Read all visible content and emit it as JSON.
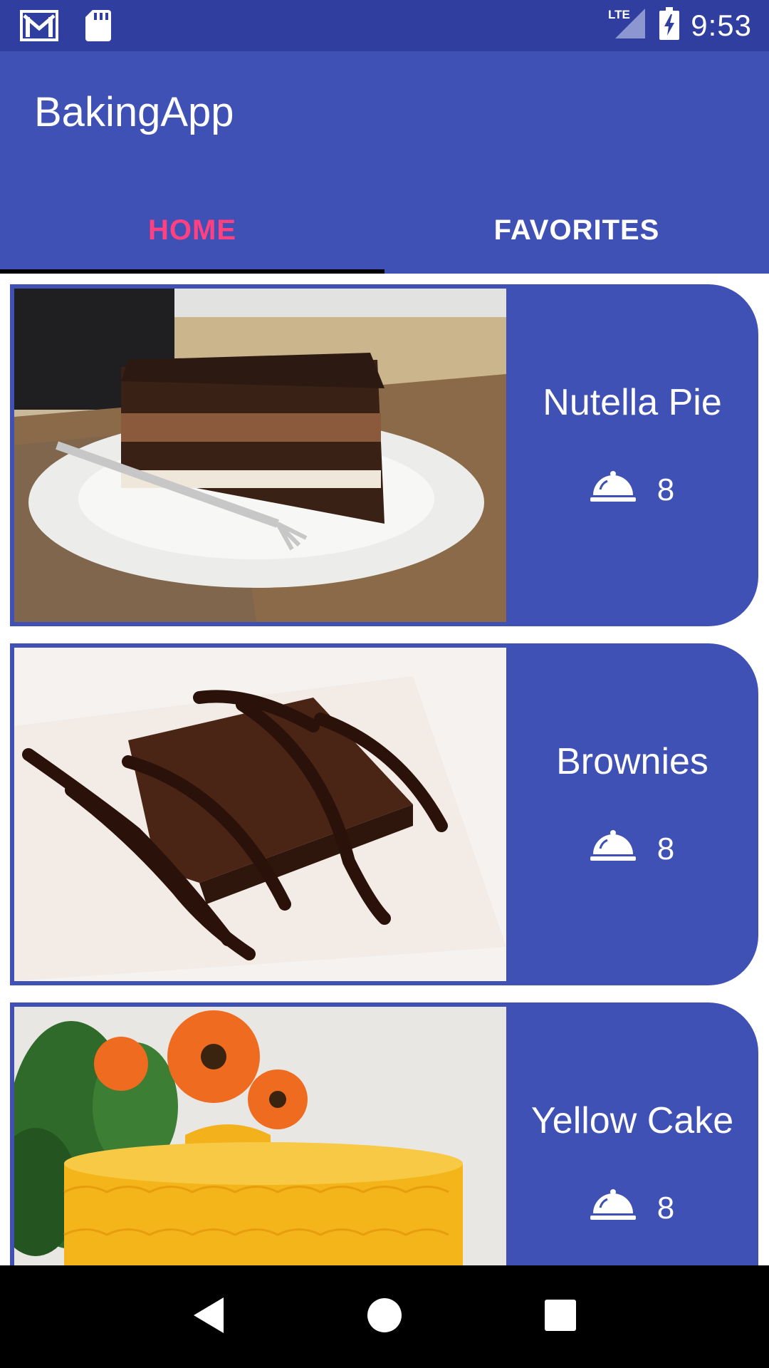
{
  "status_bar": {
    "time": "9:53",
    "network": "LTE",
    "icons": [
      "gmail-icon",
      "sd-card-icon",
      "lte-signal-icon",
      "battery-charging-icon"
    ]
  },
  "app_bar": {
    "title": "BakingApp",
    "tabs": [
      {
        "label": "HOME",
        "selected": true
      },
      {
        "label": "FAVORITES",
        "selected": false
      }
    ]
  },
  "recipes": [
    {
      "name": "Nutella Pie",
      "servings": "8",
      "image": "chocolate-layer-cake-photo"
    },
    {
      "name": "Brownies",
      "servings": "8",
      "image": "brownie-chocolate-drizzle-photo"
    },
    {
      "name": "Yellow Cake",
      "servings": "8",
      "image": "yellow-cake-flowers-photo"
    }
  ],
  "nav_bar": {
    "icons": [
      "back-icon",
      "home-icon",
      "recents-icon"
    ]
  },
  "colors": {
    "primary": "#3f51b5",
    "primary_dark": "#303f9f",
    "accent": "#ff4081",
    "tab_indicator": "#000000"
  }
}
